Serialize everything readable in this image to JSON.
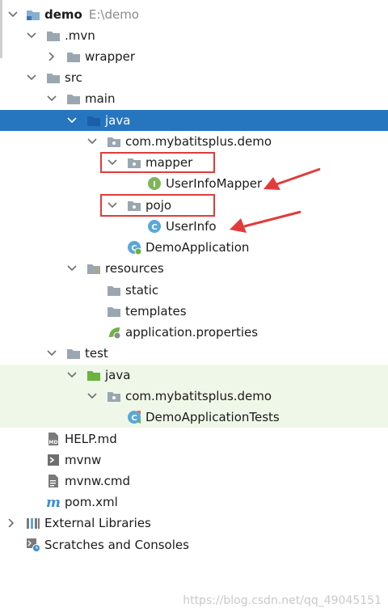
{
  "tree": {
    "project": {
      "name": "demo",
      "path": "E:\\demo"
    },
    "mvn": ".mvn",
    "wrapper": "wrapper",
    "src": "src",
    "main": "main",
    "main_java": "java",
    "main_package": "com.mybatitsplus.demo",
    "mapper": "mapper",
    "user_info_mapper": "UserInfoMapper",
    "pojo": "pojo",
    "user_info": "UserInfo",
    "demo_application": "DemoApplication",
    "resources": "resources",
    "static": "static",
    "templates": "templates",
    "application_properties": "application.properties",
    "test": "test",
    "test_java": "java",
    "test_package": "com.mybatitsplus.demo",
    "demo_application_tests": "DemoApplicationTests",
    "help_md": "HELP.md",
    "mvnw": "mvnw",
    "mvnw_cmd": "mvnw.cmd",
    "pom_xml": "pom.xml",
    "external_libraries": "External Libraries",
    "scratches": "Scratches and Consoles"
  },
  "icons": {
    "folder": "folder-icon",
    "package": "package-icon",
    "interface": "interface-icon",
    "class": "class-icon",
    "spring_boot_class": "spring-boot-class-icon",
    "markdown": "markdown-icon",
    "executable": "executable-icon",
    "text_file": "text-file-icon",
    "maven": "maven-icon",
    "library": "library-icon",
    "scratches": "scratches-icon",
    "properties": "spring-properties-icon"
  },
  "colors": {
    "selection": "#2675BF",
    "test_background": "#EFF7E9",
    "annotation_red": "#E23B3B",
    "folder_blue": "#87AFD1",
    "interface_green": "#7FB55A",
    "class_blue": "#59A8D8"
  },
  "watermark": "https://blog.csdn.net/qq_49045151"
}
